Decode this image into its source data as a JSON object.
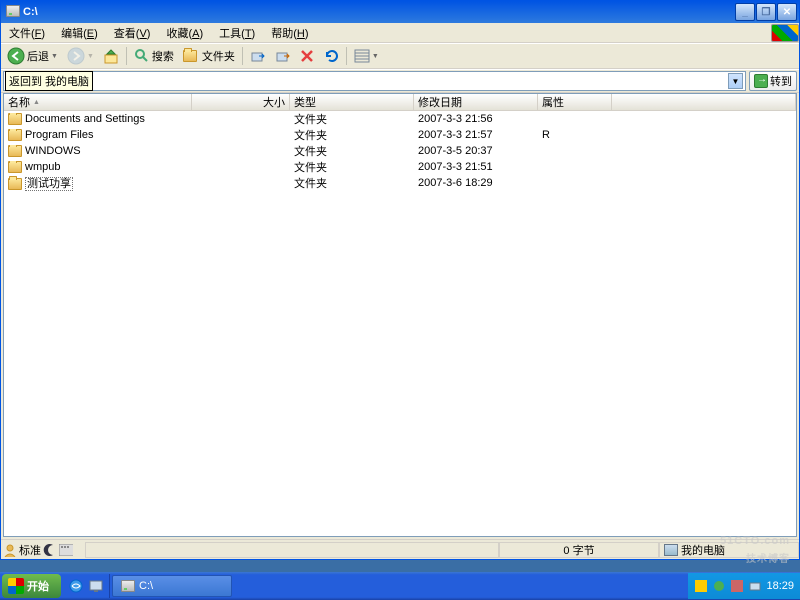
{
  "window": {
    "title": "C:\\"
  },
  "menu": {
    "file": {
      "label": "文件",
      "hotkey": "F"
    },
    "edit": {
      "label": "编辑",
      "hotkey": "E"
    },
    "view": {
      "label": "查看",
      "hotkey": "V"
    },
    "fav": {
      "label": "收藏",
      "hotkey": "A"
    },
    "tools": {
      "label": "工具",
      "hotkey": "T"
    },
    "help": {
      "label": "帮助",
      "hotkey": "H"
    }
  },
  "toolbar": {
    "back": "后退",
    "search": "搜索",
    "folders": "文件夹"
  },
  "tooltip": "返回到 我的电脑",
  "address": {
    "value": "",
    "go": "转到"
  },
  "columns": {
    "name": "名称",
    "size": "大小",
    "type": "类型",
    "modified": "修改日期",
    "attr": "属性"
  },
  "rows": [
    {
      "name": "Documents and Settings",
      "type": "文件夹",
      "modified": "2007-3-3 21:56",
      "attr": ""
    },
    {
      "name": "Program Files",
      "type": "文件夹",
      "modified": "2007-3-3 21:57",
      "attr": "R"
    },
    {
      "name": "WINDOWS",
      "type": "文件夹",
      "modified": "2007-3-5 20:37",
      "attr": ""
    },
    {
      "name": "wmpub",
      "type": "文件夹",
      "modified": "2007-3-3 21:51",
      "attr": ""
    },
    {
      "name": "测试功享",
      "type": "文件夹",
      "modified": "2007-3-6 18:29",
      "attr": "",
      "selected": true
    }
  ],
  "statusbar": {
    "left_label": "标准",
    "bytes": "0 字节",
    "location": "我的电脑"
  },
  "taskbar": {
    "start": "开始",
    "task1": "C:\\",
    "clock": "18:29"
  },
  "watermark": {
    "main": "51CTO.com",
    "sub": "技术博客"
  },
  "col_widths": {
    "name": 188,
    "size": 98,
    "type": 124,
    "modified": 124,
    "attr": 74
  }
}
